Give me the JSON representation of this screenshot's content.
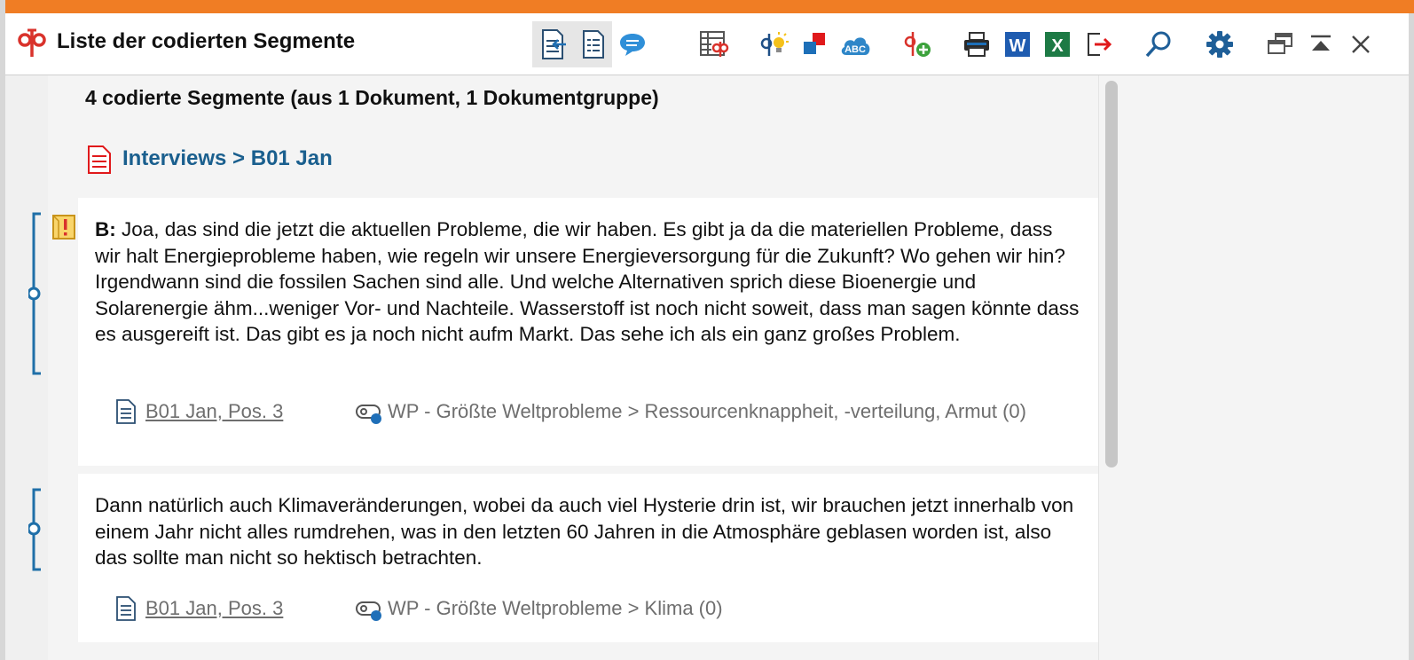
{
  "window": {
    "title": "Liste der codierten Segmente",
    "accent_color": "#f07d24"
  },
  "toolbar": {
    "buttons": [
      {
        "icon": "jump-to-document-icon"
      },
      {
        "icon": "show-document-list-icon"
      },
      {
        "icon": "comment-bubble-icon"
      },
      {
        "icon": "code-table-icon"
      },
      {
        "icon": "code-idea-icon"
      },
      {
        "icon": "highlight-colors-icon"
      },
      {
        "icon": "word-cloud-abc-icon"
      },
      {
        "icon": "add-code-icon"
      },
      {
        "icon": "print-icon"
      },
      {
        "icon": "word-export-icon"
      },
      {
        "icon": "excel-export-icon"
      },
      {
        "icon": "export-icon"
      },
      {
        "icon": "search-icon"
      },
      {
        "icon": "settings-gear-icon"
      },
      {
        "icon": "undock-window-icon"
      },
      {
        "icon": "maximize-panel-icon"
      },
      {
        "icon": "close-icon"
      }
    ]
  },
  "summary": "4 codierte Segmente (aus 1 Dokument, 1 Dokumentgruppe)",
  "document_header": "Interviews > B01 Jan",
  "segments": [
    {
      "speaker": "B:",
      "text": " Joa, das sind die jetzt die aktuellen Probleme, die wir haben. Es gibt ja da die materiellen Probleme, dass wir halt Energieprobleme haben, wie regeln wir unsere Energieversorgung für die Zukunft? Wo gehen wir hin? Irgendwann sind die fossilen Sachen sind alle. Und welche Alternativen sprich diese Bioenergie und Solarenergie ähm...weniger Vor- und Nachteile. Wasserstoff ist noch nicht soweit, dass man sagen könnte dass es ausgereift ist. Das gibt es ja noch nicht aufm Markt. Das sehe ich als ein ganz großes Problem.",
      "position": "B01 Jan, Pos. 3",
      "code": "WP - Größte Weltprobleme > Ressourcenknappheit, -verteilung, Armut (0)",
      "has_memo": true
    },
    {
      "speaker": "",
      "text": "Dann natürlich auch Klimaveränderungen, wobei da auch viel Hysterie drin ist, wir brauchen jetzt innerhalb von einem Jahr nicht alles rumdrehen, was in den letzten 60 Jahren in die Atmosphäre geblasen worden ist, also das sollte man nicht so hektisch betrachten.",
      "position": "B01 Jan, Pos. 3",
      "code": "WP - Größte Weltprobleme > Klima (0)",
      "has_memo": false
    }
  ]
}
